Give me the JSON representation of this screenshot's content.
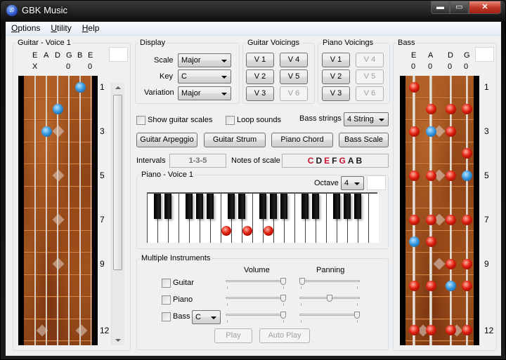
{
  "window": {
    "title": "GBK Music",
    "buttons": {
      "minimize": "▬",
      "maximize": "▭",
      "close": "✕"
    }
  },
  "menu": [
    {
      "label": "Options",
      "mnemonic": "O",
      "rest": "ptions"
    },
    {
      "label": "Utility",
      "mnemonic": "U",
      "rest": "tility"
    },
    {
      "label": "Help",
      "mnemonic": "H",
      "rest": "elp"
    }
  ],
  "guitar": {
    "title": "Guitar - Voice 1",
    "strings": [
      "E",
      "A",
      "D",
      "G",
      "B",
      "E"
    ],
    "open_marks": [
      "X",
      "",
      "",
      "0",
      "",
      "0"
    ],
    "fret_numbers": [
      "1",
      "3",
      "5",
      "7",
      "9",
      "12"
    ],
    "notes": [
      {
        "string": 4,
        "fret": 1,
        "color": "blue"
      },
      {
        "string": 2,
        "fret": 2,
        "color": "blue"
      },
      {
        "string": 1,
        "fret": 3,
        "color": "blue"
      }
    ],
    "scroll_position": 0.0
  },
  "display": {
    "title": "Display",
    "scale_label": "Scale",
    "scale_value": "Major",
    "key_label": "Key",
    "key_value": "C",
    "variation_label": "Variation",
    "variation_value": "Major"
  },
  "guitar_voicings": {
    "title": "Guitar Voicings",
    "buttons": [
      {
        "label": "V 1",
        "enabled": true
      },
      {
        "label": "V 4",
        "enabled": true
      },
      {
        "label": "V 2",
        "enabled": true
      },
      {
        "label": "V 5",
        "enabled": true
      },
      {
        "label": "V 3",
        "enabled": true
      },
      {
        "label": "V 6",
        "enabled": false
      }
    ]
  },
  "piano_voicings": {
    "title": "Piano Voicings",
    "buttons": [
      {
        "label": "V 1",
        "enabled": true
      },
      {
        "label": "V 4",
        "enabled": false
      },
      {
        "label": "V 2",
        "enabled": true
      },
      {
        "label": "V 5",
        "enabled": false
      },
      {
        "label": "V 3",
        "enabled": true
      },
      {
        "label": "V 6",
        "enabled": false
      }
    ]
  },
  "options": {
    "show_guitar_scales": {
      "label": "Show guitar scales",
      "checked": false
    },
    "loop_sounds": {
      "label": "Loop sounds",
      "checked": false
    },
    "bass_strings_label": "Bass strings",
    "bass_strings_value": "4 String"
  },
  "actions": {
    "guitar_arpeggio": "Guitar Arpeggio",
    "guitar_strum": "Guitar Strum",
    "piano_chord": "Piano Chord",
    "bass_scale": "Bass Scale"
  },
  "intervals": {
    "label": "Intervals",
    "value": "1-3-5"
  },
  "notes_of_scale": {
    "label": "Notes of scale",
    "notes": [
      {
        "note": "C",
        "chord_tone": true
      },
      {
        "note": "D",
        "chord_tone": false
      },
      {
        "note": "E",
        "chord_tone": true
      },
      {
        "note": "F",
        "chord_tone": false
      },
      {
        "note": "G",
        "chord_tone": true
      },
      {
        "note": "A",
        "chord_tone": false
      },
      {
        "note": "B",
        "chord_tone": false
      }
    ],
    "chord_tone_color": "#c8102e",
    "other_color": "#1a1a1a"
  },
  "piano": {
    "title": "Piano - Voice 1",
    "octave_label": "Octave",
    "octave_value": "4",
    "white_key_count": 22,
    "highlighted_white_keys": [
      7,
      9,
      11
    ]
  },
  "multiple_instruments": {
    "title": "Multiple Instruments",
    "volume_label": "Volume",
    "panning_label": "Panning",
    "instruments": [
      {
        "label": "Guitar",
        "checked": false,
        "volume": 1.0,
        "panning": 0.0
      },
      {
        "label": "Piano",
        "checked": false,
        "volume": 1.0,
        "panning": 0.5
      },
      {
        "label": "Bass",
        "checked": false,
        "volume": 1.0,
        "panning": 1.0,
        "key": "C"
      }
    ],
    "play_label": "Play",
    "auto_play_label": "Auto Play"
  },
  "bass": {
    "title": "Bass",
    "strings": [
      "E",
      "A",
      "D",
      "G"
    ],
    "open_marks": [
      "0",
      "0",
      "0",
      "0"
    ],
    "fret_numbers": [
      "1",
      "3",
      "5",
      "7",
      "9",
      "12"
    ],
    "notes": [
      {
        "string": 0,
        "fret": 1,
        "color": "red"
      },
      {
        "string": 1,
        "fret": 2,
        "color": "red"
      },
      {
        "string": 2,
        "fret": 2,
        "color": "red"
      },
      {
        "string": 3,
        "fret": 2,
        "color": "red"
      },
      {
        "string": 0,
        "fret": 3,
        "color": "red"
      },
      {
        "string": 1,
        "fret": 3,
        "color": "blue"
      },
      {
        "string": 2,
        "fret": 3,
        "color": "red"
      },
      {
        "string": 3,
        "fret": 4,
        "color": "red"
      },
      {
        "string": 0,
        "fret": 5,
        "color": "red"
      },
      {
        "string": 1,
        "fret": 5,
        "color": "red"
      },
      {
        "string": 2,
        "fret": 5,
        "color": "red"
      },
      {
        "string": 3,
        "fret": 5,
        "color": "blue"
      },
      {
        "string": 0,
        "fret": 7,
        "color": "red"
      },
      {
        "string": 1,
        "fret": 7,
        "color": "red"
      },
      {
        "string": 2,
        "fret": 7,
        "color": "red"
      },
      {
        "string": 3,
        "fret": 7,
        "color": "red"
      },
      {
        "string": 0,
        "fret": 8,
        "color": "blue"
      },
      {
        "string": 1,
        "fret": 8,
        "color": "red"
      },
      {
        "string": 2,
        "fret": 9,
        "color": "red"
      },
      {
        "string": 3,
        "fret": 9,
        "color": "red"
      },
      {
        "string": 0,
        "fret": 10,
        "color": "red"
      },
      {
        "string": 1,
        "fret": 10,
        "color": "red"
      },
      {
        "string": 2,
        "fret": 10,
        "color": "blue"
      },
      {
        "string": 3,
        "fret": 10,
        "color": "red"
      },
      {
        "string": 0,
        "fret": 12,
        "color": "red"
      },
      {
        "string": 1,
        "fret": 12,
        "color": "red"
      },
      {
        "string": 2,
        "fret": 12,
        "color": "red"
      },
      {
        "string": 3,
        "fret": 12,
        "color": "red"
      }
    ]
  }
}
